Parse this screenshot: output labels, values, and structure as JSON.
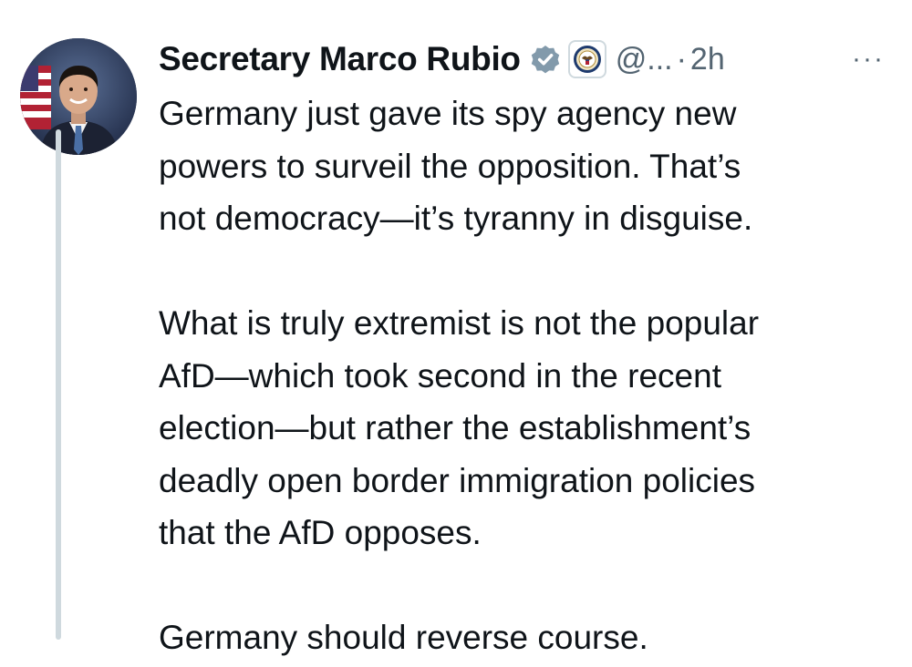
{
  "author": {
    "name": "Secretary Marco Rubio",
    "handle": "@...",
    "separator": "·",
    "timestamp": "2h",
    "verified_icon": "verified-badge-icon",
    "affiliation_icon": "state-department-seal-icon",
    "avatar_icon": "profile-photo"
  },
  "menu": {
    "more_label": "···"
  },
  "tweet": {
    "paragraphs": [
      {
        "lines": [
          "Germany just gave its spy agency new",
          "powers to surveil the opposition.  That’s",
          "not democracy—it’s tyranny in disguise."
        ]
      },
      {
        "lines": [
          "What is truly extremist is not the popular",
          "AfD—which took second in the recent",
          "election—but rather the establishment’s",
          "deadly open border immigration policies",
          "that the AfD opposes."
        ]
      },
      {
        "lines": [
          "Germany should reverse course."
        ]
      }
    ]
  },
  "colors": {
    "text": "#0f1419",
    "secondary": "#536471",
    "thread_line": "#cfd9de",
    "verified_badge": "#829aab"
  }
}
